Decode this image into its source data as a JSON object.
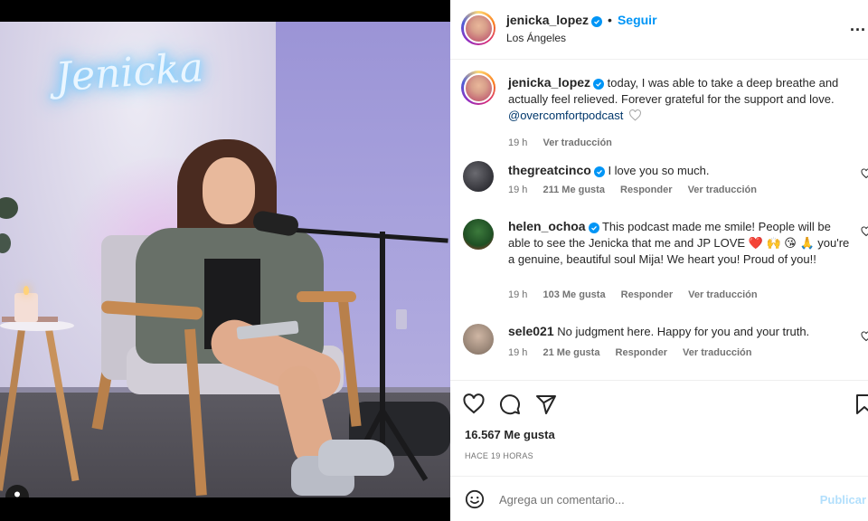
{
  "post": {
    "author": "jenicka_lopez",
    "follow_label": "Seguir",
    "location": "Los Ángeles",
    "separator": "•",
    "more_label": "..."
  },
  "photo": {
    "neon_text": "Jenicka"
  },
  "caption": {
    "author": "jenicka_lopez",
    "text": "today, I was able to take a deep breathe and actually feel relieved. Forever grateful for the support and love.",
    "mention": "@overcomfortpodcast",
    "time": "19 h",
    "translate_label": "Ver traducción"
  },
  "comments": [
    {
      "author": "thegreatcinco",
      "verified": true,
      "text": "I love you so much.",
      "time": "19 h",
      "likes": "211 Me gusta",
      "reply": "Responder",
      "translate": "Ver traducción"
    },
    {
      "author": "helen_ochoa",
      "verified": true,
      "text": "This podcast made me smile! People will be able to see the Jenicka that me and JP LOVE ❤️ 🙌 😘 🙏 you're a genuine, beautiful soul Mija! We heart you! Proud of you!!",
      "time": "19 h",
      "likes": "103 Me gusta",
      "reply": "Responder",
      "translate": "Ver traducción"
    },
    {
      "author": "sele021",
      "verified": false,
      "text": "No judgment here. Happy for you and your truth.",
      "time": "19 h",
      "likes": "21 Me gusta",
      "reply": "Responder",
      "translate": "Ver traducción"
    }
  ],
  "stats": {
    "likes": "16.567 Me gusta",
    "ago": "HACE 19 HORAS"
  },
  "composer": {
    "placeholder": "Agrega un comentario...",
    "publish_label": "Publicar"
  },
  "colors": {
    "accent": "#0095f6",
    "muted": "#737373",
    "text": "#262626"
  }
}
